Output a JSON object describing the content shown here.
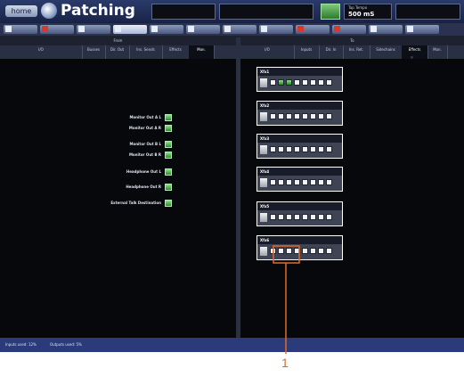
{
  "header": {
    "home_label": "home",
    "title": "Patching",
    "tap_tempo_label": "Tap Tempo",
    "tap_tempo_value": "500 mS"
  },
  "panels": {
    "from": {
      "title": "From",
      "tabs": [
        "I/O",
        "Busses",
        "Dir. Out",
        "Ins. Sends",
        "Effects",
        "Mon."
      ],
      "active_tab": "Mon."
    },
    "to": {
      "title": "To",
      "tabs": [
        "I/O",
        "Inputs",
        "Dir. In",
        "Ins. Ret.",
        "Sidechains",
        "Effects",
        "Mon."
      ],
      "active_tab": "Effects"
    }
  },
  "monitor_outputs": [
    "Monitor Out A L",
    "Monitor Out A R",
    "Monitor Out B L",
    "Monitor Out B R",
    "Headphone Out L",
    "Headphone Out R",
    "External Talk Destination"
  ],
  "effects": [
    {
      "name": "Xfx1",
      "patched_ports": [
        1,
        2
      ]
    },
    {
      "name": "Xfx2",
      "patched_ports": []
    },
    {
      "name": "Xfx3",
      "patched_ports": []
    },
    {
      "name": "Xfx4",
      "patched_ports": []
    },
    {
      "name": "Xfx5",
      "patched_ports": []
    },
    {
      "name": "Xfx6",
      "patched_ports": []
    }
  ],
  "status": {
    "inputs_used": "Inputs used: 12%",
    "outputs_used": "Outputs used: 5%"
  },
  "callout": {
    "number": "1",
    "color": "#e06a2a"
  },
  "colors": {
    "patched": "#3ea83a",
    "panel_bg": "#06080c",
    "title_bar": "#1a2448"
  }
}
